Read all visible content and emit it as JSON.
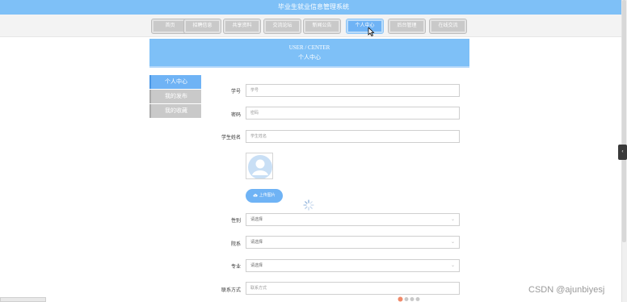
{
  "app": {
    "title": "毕业生就业信息管理系统"
  },
  "nav": {
    "items": [
      {
        "label": "首页"
      },
      {
        "label": "招聘信息"
      },
      {
        "label": "共享资料"
      },
      {
        "label": "交流论坛"
      },
      {
        "label": "新闻公告"
      },
      {
        "label": "个人中心"
      },
      {
        "label": "后台管理"
      },
      {
        "label": "在线交流"
      }
    ],
    "active": "个人中心"
  },
  "banner": {
    "en": "USER / CENTER",
    "cn": "个人中心"
  },
  "sidebar": {
    "items": [
      {
        "label": "个人中心"
      },
      {
        "label": "我的发布"
      },
      {
        "label": "我的收藏"
      }
    ],
    "active": "个人中心"
  },
  "form": {
    "student_id": {
      "label": "学号",
      "placeholder": "学号"
    },
    "password": {
      "label": "密码",
      "placeholder": "密码"
    },
    "student_name": {
      "label": "学生姓名",
      "placeholder": "学生姓名"
    },
    "upload_label": "上传图片",
    "gender": {
      "label": "性别",
      "value": "请选择"
    },
    "department": {
      "label": "院系",
      "value": "请选择"
    },
    "major": {
      "label": "专业",
      "value": "请选择"
    },
    "contact": {
      "label": "联系方式",
      "placeholder": "联系方式"
    }
  },
  "icons": {
    "avatar": "user-avatar-icon",
    "upload": "cloud-upload-icon",
    "spinner": "loading-spinner-icon",
    "chevron": "chevron-down-icon"
  },
  "colors": {
    "primary": "#7ec0f7",
    "active": "#6fb3f5",
    "inactive": "#c9c9c9"
  },
  "watermark": "CSDN @ajunbiyesj"
}
